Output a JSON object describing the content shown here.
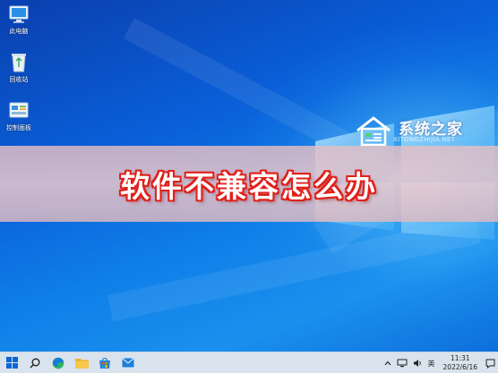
{
  "desktop": {
    "icons": [
      {
        "label": "此电脑",
        "icon": "computer-icon"
      },
      {
        "label": "回收站",
        "icon": "recycle-bin-icon"
      },
      {
        "label": "控制面板",
        "icon": "control-panel-icon"
      }
    ]
  },
  "watermark": {
    "name": "系统之家",
    "url": "XITONGZHIJIA.NET"
  },
  "banner": {
    "title": "软件不兼容怎么办"
  },
  "taskbar": {
    "apps": [
      "windows-start-icon",
      "search-icon",
      "edge-browser-icon",
      "file-explorer-icon",
      "microsoft-store-icon",
      "mail-icon"
    ],
    "tray": {
      "lang": "英",
      "time": "11:31",
      "date": "2022/6/16"
    }
  },
  "colors": {
    "banner_text_outline": "#e0201a",
    "taskbar_bg": "#d9e3ee"
  }
}
